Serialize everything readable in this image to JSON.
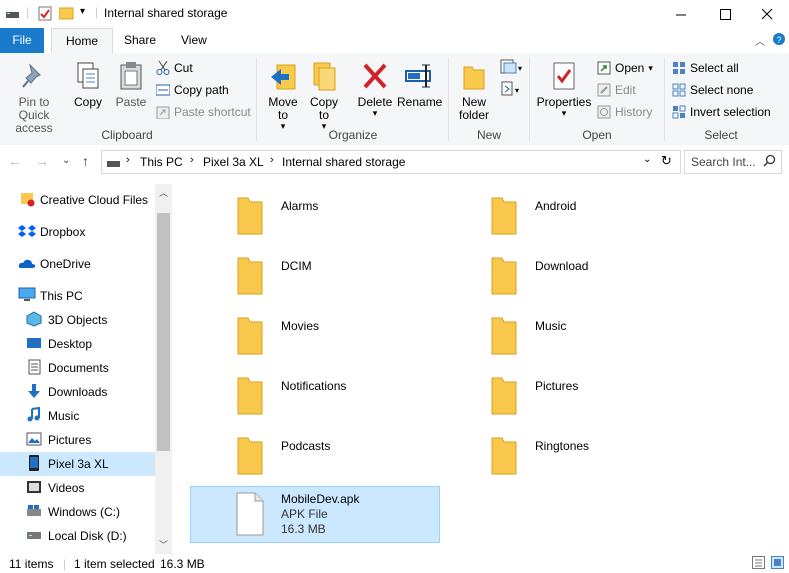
{
  "window": {
    "title": "Internal shared storage"
  },
  "ribbon_tabs": [
    "File",
    "Home",
    "Share",
    "View"
  ],
  "ribbon": {
    "clipboard": {
      "label": "Clipboard",
      "pin": "Pin to Quick access",
      "copy": "Copy",
      "paste": "Paste",
      "cut": "Cut",
      "copy_path": "Copy path",
      "paste_shortcut": "Paste shortcut"
    },
    "organize": {
      "label": "Organize",
      "move_to": "Move to",
      "copy_to": "Copy to",
      "delete": "Delete",
      "rename": "Rename"
    },
    "new": {
      "label": "New",
      "new_folder": "New folder"
    },
    "open": {
      "label": "Open",
      "properties": "Properties",
      "open": "Open",
      "edit": "Edit",
      "history": "History"
    },
    "select": {
      "label": "Select",
      "select_all": "Select all",
      "select_none": "Select none",
      "invert": "Invert selection"
    }
  },
  "address": {
    "crumbs": [
      "This PC",
      "Pixel 3a XL",
      "Internal shared storage"
    ],
    "search_placeholder": "Search Int..."
  },
  "sidebar": [
    {
      "label": "Creative Cloud Files",
      "icon": "creative-cloud-icon"
    },
    {
      "label": "Dropbox",
      "icon": "dropbox-icon"
    },
    {
      "label": "OneDrive",
      "icon": "onedrive-icon"
    },
    {
      "label": "This PC",
      "icon": "pc-icon"
    },
    {
      "label": "3D Objects",
      "icon": "3d-objects-icon"
    },
    {
      "label": "Desktop",
      "icon": "desktop-icon"
    },
    {
      "label": "Documents",
      "icon": "documents-icon"
    },
    {
      "label": "Downloads",
      "icon": "downloads-icon"
    },
    {
      "label": "Music",
      "icon": "music-icon"
    },
    {
      "label": "Pictures",
      "icon": "pictures-icon"
    },
    {
      "label": "Pixel 3a XL",
      "icon": "phone-icon"
    },
    {
      "label": "Videos",
      "icon": "videos-icon"
    },
    {
      "label": "Windows (C:)",
      "icon": "drive-c-icon"
    },
    {
      "label": "Local Disk (D:)",
      "icon": "drive-d-icon"
    }
  ],
  "folders": [
    "Alarms",
    "Android",
    "DCIM",
    "Download",
    "Movies",
    "Music",
    "Notifications",
    "Pictures",
    "Podcasts",
    "Ringtones"
  ],
  "selected_file": {
    "name": "MobileDev.apk",
    "type": "APK File",
    "size": "16.3 MB"
  },
  "status": {
    "items": "11 items",
    "selected": "1 item selected",
    "size": "16.3 MB"
  },
  "colors": {
    "accent": "#1979ca",
    "selection": "#cce8ff",
    "folder": "#f8c94c"
  }
}
